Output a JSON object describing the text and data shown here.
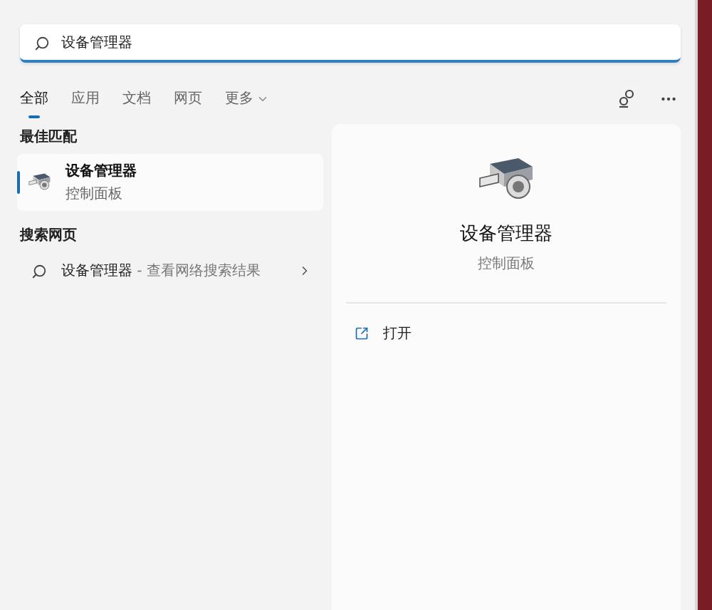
{
  "search": {
    "value": "设备管理器"
  },
  "tabs": [
    {
      "label": "全部",
      "selected": true,
      "kind": "tab"
    },
    {
      "label": "应用",
      "selected": false,
      "kind": "tab"
    },
    {
      "label": "文档",
      "selected": false,
      "kind": "tab"
    },
    {
      "label": "网页",
      "selected": false,
      "kind": "tab"
    },
    {
      "label": "更多",
      "selected": false,
      "kind": "dropdown"
    }
  ],
  "best_match": {
    "heading": "最佳匹配",
    "item": {
      "title": "设备管理器",
      "subtitle": "控制面板",
      "selected": true
    }
  },
  "web_search": {
    "heading": "搜索网页",
    "item": {
      "title": "设备管理器",
      "suffix": " - 查看网络搜索结果"
    }
  },
  "detail": {
    "title": "设备管理器",
    "subtitle": "控制面板",
    "actions": [
      {
        "label": "打开"
      }
    ]
  }
}
